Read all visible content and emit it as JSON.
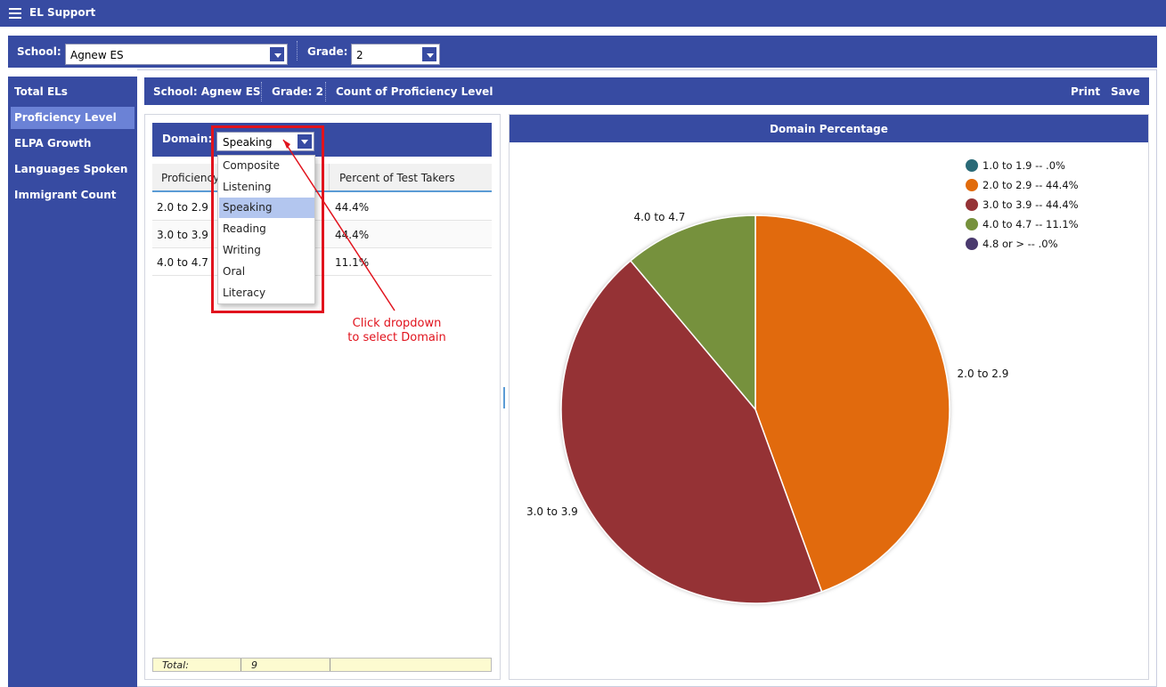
{
  "app": {
    "title": "EL Support",
    "menu_icon": "hamburger-icon"
  },
  "filters": {
    "school_label": "School:",
    "school_value": "Agnew ES",
    "grade_label": "Grade:",
    "grade_value": "2"
  },
  "sidebar": {
    "items": [
      {
        "label": "Total ELs",
        "active": false
      },
      {
        "label": "Proficiency Level",
        "active": true
      },
      {
        "label": "ELPA Growth",
        "active": false
      },
      {
        "label": "Languages Spoken",
        "active": false
      },
      {
        "label": "Immigrant Count",
        "active": false
      }
    ]
  },
  "content_header": {
    "school": "School: Agnew ES",
    "grade": "Grade: 2",
    "report": "Count of Proficiency Level",
    "print_label": "Print",
    "save_label": "Save"
  },
  "domain": {
    "label": "Domain:",
    "value": "Speaking",
    "options": [
      "Composite",
      "Listening",
      "Speaking",
      "Reading",
      "Writing",
      "Oral",
      "Literacy"
    ],
    "selected_index": 2
  },
  "grid": {
    "columns": [
      "Proficiency Level",
      "Percent of Test Takers"
    ],
    "rows": [
      {
        "level": "2.0 to 2.9",
        "percent": "44.4%"
      },
      {
        "level": "3.0 to 3.9",
        "percent": "44.4%"
      },
      {
        "level": "4.0 to 4.7",
        "percent": "11.1%"
      }
    ],
    "footer": {
      "label": "Total:",
      "value": "9"
    }
  },
  "annotation": {
    "line1": "Click dropdown",
    "line2": "to select Domain",
    "color": "#e1131d"
  },
  "colors": {
    "header_blue": "#374ba2",
    "sidebar_active": "#6b82d6"
  },
  "chart_data": {
    "type": "pie",
    "title": "Domain Percentage",
    "slices": [
      {
        "label": "1.0 to 1.9",
        "legend": "1.0 to 1.9 -- .0%",
        "value": 0.0,
        "color": "#2a6a77",
        "show_label": false
      },
      {
        "label": "2.0 to 2.9",
        "legend": "2.0 to 2.9 -- 44.4%",
        "value": 44.4,
        "color": "#e16b0c",
        "show_label": true
      },
      {
        "label": "3.0 to 3.9",
        "legend": "3.0 to 3.9 -- 44.4%",
        "value": 44.4,
        "color": "#953336",
        "show_label": true
      },
      {
        "label": "4.0 to 4.7",
        "legend": "4.0 to 4.7 -- 11.1%",
        "value": 11.1,
        "color": "#76913c",
        "show_label": true
      },
      {
        "label": "4.8 or >",
        "legend": "4.8 or > -- .0%",
        "value": 0.0,
        "color": "#4a3a6e",
        "show_label": false
      }
    ],
    "legend_position": "top-right"
  }
}
